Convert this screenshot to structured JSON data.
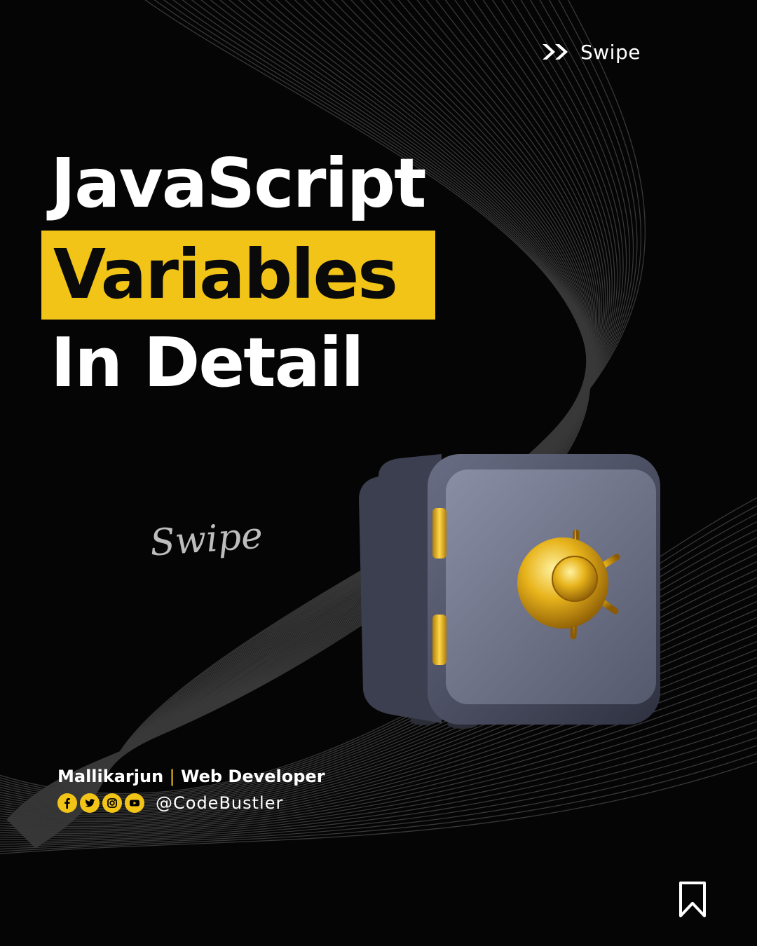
{
  "header": {
    "swipe_label": "Swipe",
    "swipe_icon": "double-chevron-right-icon"
  },
  "title": {
    "line1": "JavaScript",
    "line2": "Variables",
    "line3": "In Detail"
  },
  "swipe_hint": "Swipe",
  "illustration": "safe-vault-icon",
  "author": {
    "name": "Mallikarjun",
    "separator": "|",
    "role": "Web Developer",
    "handle": "@CodeBustler"
  },
  "socials": [
    "facebook-icon",
    "twitter-icon",
    "instagram-icon",
    "youtube-icon"
  ],
  "bookmark_icon": "bookmark-icon",
  "colors": {
    "accent": "#f2c418",
    "background": "#050505",
    "text": "#ffffff"
  }
}
